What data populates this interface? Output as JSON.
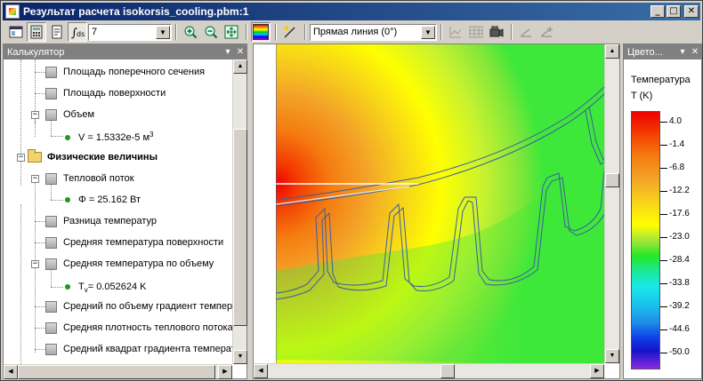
{
  "window": {
    "title": "Результат расчета isokorsis_cooling.pbm:1",
    "minimize": "_",
    "maximize": "□",
    "close": "✕"
  },
  "toolbar": {
    "level_combo_value": "7",
    "line_combo_value": "Прямая линия (0°)"
  },
  "calculator": {
    "title": "Калькулятор",
    "pin": "▾",
    "close": "✕",
    "items": [
      {
        "label": "Площадь поперечного сечения",
        "kind": "leaf"
      },
      {
        "label": "Площадь поверхности",
        "kind": "leaf"
      },
      {
        "label": "Объем",
        "kind": "expanded"
      },
      {
        "label": "V = 1.5332e-5 м",
        "sup": "3",
        "kind": "value"
      },
      {
        "label": "Физические величины",
        "kind": "folder"
      },
      {
        "label": "Тепловой поток",
        "kind": "expanded"
      },
      {
        "label": "Φ = 25.162 Вт",
        "kind": "value"
      },
      {
        "label": "Разница температур",
        "kind": "leaf"
      },
      {
        "label": "Средняя температура поверхности",
        "kind": "leaf"
      },
      {
        "label": "Средняя температура по объему",
        "kind": "expanded"
      },
      {
        "label": "T",
        "sub": "v",
        "rest": " = 0.052624 K",
        "kind": "value"
      },
      {
        "label": "Средний по объему градиент температуры",
        "kind": "leaf"
      },
      {
        "label": "Средняя плотность теплового потока",
        "kind": "leaf"
      },
      {
        "label": "Средний квадрат градиента температуры",
        "kind": "leaf"
      }
    ]
  },
  "legend_panel": {
    "title": "Цвето...",
    "pin": "▾",
    "close": "✕",
    "quantity": "Температура",
    "unit": "T (K)",
    "ticks": [
      "4.0",
      "-1.4",
      "-6.8",
      "-12.2",
      "-17.6",
      "-23.0",
      "-28.4",
      "-33.8",
      "-39.2",
      "-44.6",
      "-50.0"
    ],
    "colors": [
      "#ee0000",
      "#f57a10",
      "#ffff00",
      "#25e825",
      "#19e8e8",
      "#1e8ee8",
      "#1414c8",
      "#8a2be2"
    ]
  },
  "icons": [
    "results-window-icon",
    "calculator-icon",
    "export-icon",
    "integral-icon",
    "zoom-in-icon",
    "zoom-out-icon",
    "zoom-fit-icon",
    "color-map-icon",
    "add-line-icon",
    "graph-icon",
    "table-icon",
    "camera-icon",
    "step-back-icon",
    "step-forward-icon"
  ]
}
